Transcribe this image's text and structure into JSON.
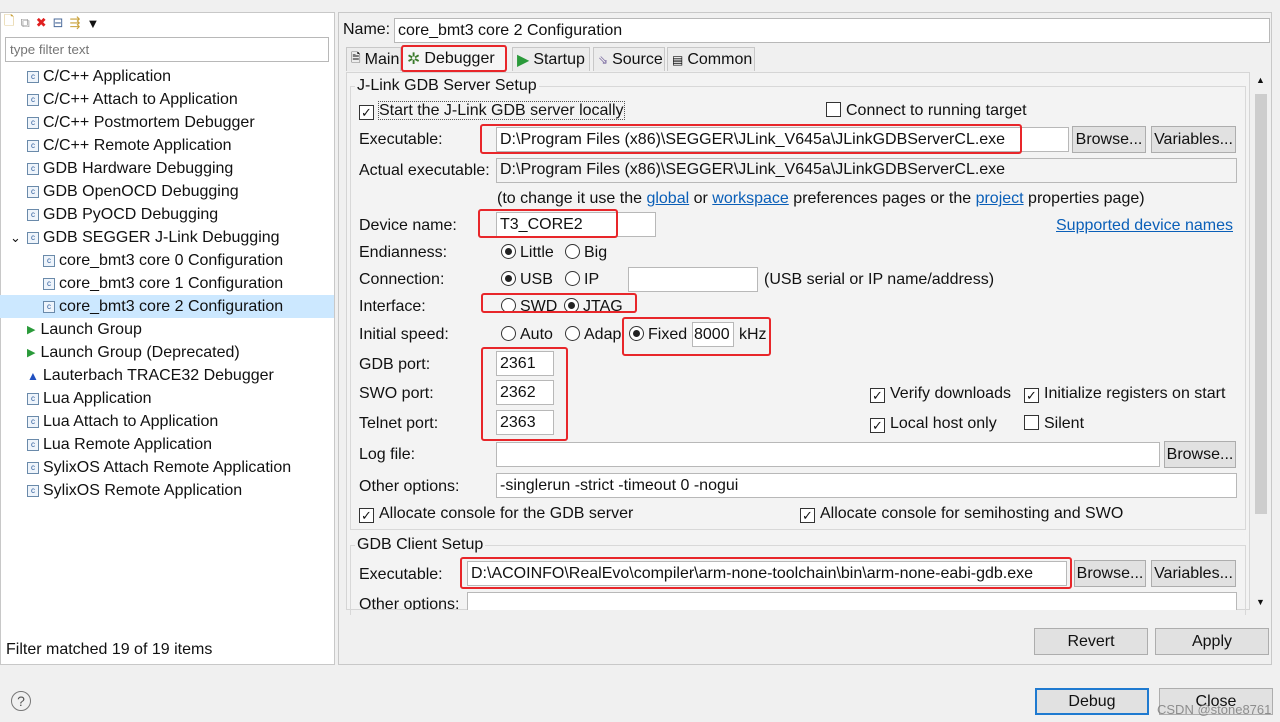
{
  "left": {
    "filter_placeholder": "type filter text",
    "items": [
      {
        "label": "C/C++ Application"
      },
      {
        "label": "C/C++ Attach to Application"
      },
      {
        "label": "C/C++ Postmortem Debugger"
      },
      {
        "label": "C/C++ Remote Application"
      },
      {
        "label": "GDB Hardware Debugging"
      },
      {
        "label": "GDB OpenOCD Debugging"
      },
      {
        "label": "GDB PyOCD Debugging"
      },
      {
        "label": "GDB SEGGER J-Link Debugging"
      },
      {
        "label": "core_bmt3 core 0 Configuration"
      },
      {
        "label": "core_bmt3 core 1 Configuration"
      },
      {
        "label": "core_bmt3 core 2 Configuration"
      },
      {
        "label": "Launch Group"
      },
      {
        "label": "Launch Group (Deprecated)"
      },
      {
        "label": "Lauterbach TRACE32 Debugger"
      },
      {
        "label": "Lua Application"
      },
      {
        "label": "Lua Attach to Application"
      },
      {
        "label": "Lua Remote Application"
      },
      {
        "label": "SylixOS Attach Remote Application"
      },
      {
        "label": "SylixOS Remote Application"
      }
    ],
    "status": "Filter matched 19 of 19 items"
  },
  "name_label": "Name:",
  "name_value": "core_bmt3 core 2 Configuration",
  "tabs": [
    "Main",
    "Debugger",
    "Startup",
    "Source",
    "Common"
  ],
  "server": {
    "title": "J-Link GDB Server Setup",
    "start_locally": "Start the J-Link GDB server locally",
    "connect_running": "Connect to running target",
    "executable_label": "Executable:",
    "executable": "D:\\Program Files (x86)\\SEGGER\\JLink_V645a\\JLinkGDBServerCL.exe",
    "actual_label": "Actual executable:",
    "actual": "D:\\Program Files (x86)\\SEGGER\\JLink_V645a\\JLinkGDBServerCL.exe",
    "hint_pre": "(to change it use the",
    "hint_global": "global",
    "hint_or": "or",
    "hint_workspace": "workspace",
    "hint_mid": "preferences pages or the",
    "hint_project": "project",
    "hint_post": "properties page)",
    "device_label": "Device name:",
    "device": "T3_CORE2",
    "supported": "Supported device names",
    "endian_label": "Endianness:",
    "little": "Little",
    "big": "Big",
    "conn_label": "Connection:",
    "usb": "USB",
    "ip": "IP",
    "conn_hint": "(USB serial or IP name/address)",
    "iface_label": "Interface:",
    "swd": "SWD",
    "jtag": "JTAG",
    "speed_label": "Initial speed:",
    "auto": "Auto",
    "adap": "Adap",
    "fixed": "Fixed",
    "speed": "8000",
    "khz": "kHz",
    "gdb_port_label": "GDB port:",
    "gdb_port": "2361",
    "swo_port_label": "SWO port:",
    "swo_port": "2362",
    "telnet_port_label": "Telnet port:",
    "telnet_port": "2363",
    "verify": "Verify downloads",
    "init_regs": "Initialize registers on start",
    "local_only": "Local host only",
    "silent": "Silent",
    "log_label": "Log file:",
    "log": "",
    "other_label": "Other options:",
    "other": "-singlerun -strict -timeout 0 -nogui",
    "alloc_server": "Allocate console for the GDB server",
    "alloc_semi": "Allocate console for semihosting and SWO"
  },
  "client": {
    "title": "GDB Client Setup",
    "executable_label": "Executable:",
    "executable": "D:\\ACOINFO\\RealEvo\\compiler\\arm-none-toolchain\\bin\\arm-none-eabi-gdb.exe",
    "other_label": "Other options:"
  },
  "buttons": {
    "browse": "Browse...",
    "variables": "Variables...",
    "revert": "Revert",
    "apply": "Apply",
    "debug": "Debug",
    "close": "Close"
  },
  "watermark": "CSDN @stone8761",
  "colors": {
    "selection": "#cce8ff",
    "annotation": "#e8262a",
    "link": "#0a5fb8"
  }
}
